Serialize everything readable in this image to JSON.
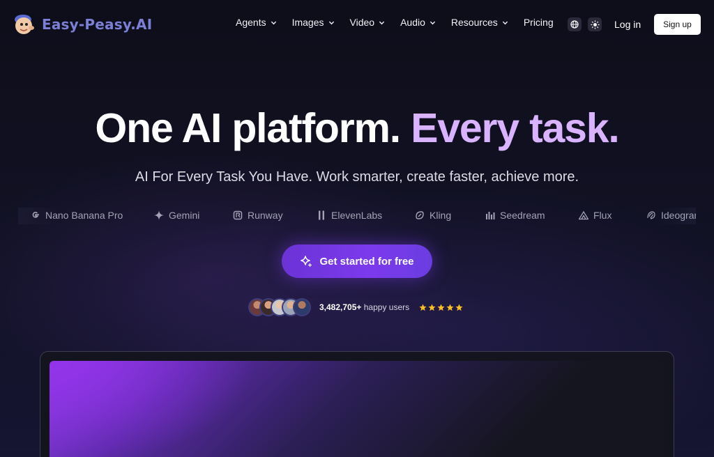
{
  "header": {
    "logo_text": "Easy-Peasy.AI",
    "nav": [
      {
        "label": "Agents",
        "dropdown": true
      },
      {
        "label": "Images",
        "dropdown": true
      },
      {
        "label": "Video",
        "dropdown": true
      },
      {
        "label": "Audio",
        "dropdown": true
      },
      {
        "label": "Resources",
        "dropdown": true
      },
      {
        "label": "Pricing",
        "dropdown": false
      }
    ],
    "icons": [
      "globe-icon",
      "sun-icon"
    ],
    "login_label": "Log in",
    "signup_label": "Sign up"
  },
  "hero": {
    "headline_main": "One AI platform.",
    "headline_accent": "Every task.",
    "subheadline": "AI For Every Task You Have. Work smarter, create faster, achieve more.",
    "brands": [
      "Nano Banana Pro",
      "Gemini",
      "Runway",
      "ElevenLabs",
      "Kling",
      "Seedream",
      "Flux",
      "Ideogram"
    ],
    "cta_label": "Get started for free",
    "users_count": "3,482,705+",
    "users_suffix": "happy users",
    "rating_stars": 5
  },
  "colors": {
    "accent": "#d9b3ff",
    "cta": "#7c3aed",
    "logo": "#7b7fd6",
    "star": "#fbbf24"
  }
}
